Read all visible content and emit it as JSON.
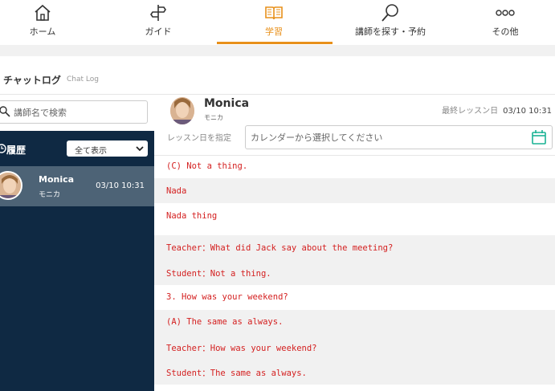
{
  "nav": {
    "items": [
      {
        "label": "ホーム",
        "icon": "home-icon"
      },
      {
        "label": "ガイド",
        "icon": "guide-icon"
      },
      {
        "label": "学習",
        "icon": "book-icon"
      },
      {
        "label": "講師を探す・予約",
        "icon": "search-icon"
      },
      {
        "label": "その他",
        "icon": "more-icon"
      }
    ],
    "active": "学習",
    "accent": "#e8901a"
  },
  "page": {
    "title": "チャットログ",
    "subtitle": "Chat Log"
  },
  "sidebar": {
    "search_placeholder": "講師名で検索",
    "history_label": "履歴",
    "filter_value": "全て表示",
    "bg_color": "#0f2943",
    "items": [
      {
        "name": "Monica",
        "kana": "モニカ",
        "date": "03/10 10:31"
      }
    ]
  },
  "teacher": {
    "name": "Monica",
    "kana": "モニカ",
    "last_lesson_label": "最終レッスン日",
    "last_lesson_date": "03/10 10:31"
  },
  "date_filter": {
    "label": "レッスン日を指定",
    "placeholder": "カレンダーから選択してください"
  },
  "log": {
    "text_color": "#d42020",
    "messages": [
      "(C) Not a thing.",
      "Nada",
      "Nada thing",
      "Teacher：What did Jack say about the meeting?",
      "Student：Not a thing.",
      "3. How was your weekend?",
      "(A) The same as always.",
      "Teacher：How was your weekend?",
      "Student：The same as always."
    ]
  }
}
